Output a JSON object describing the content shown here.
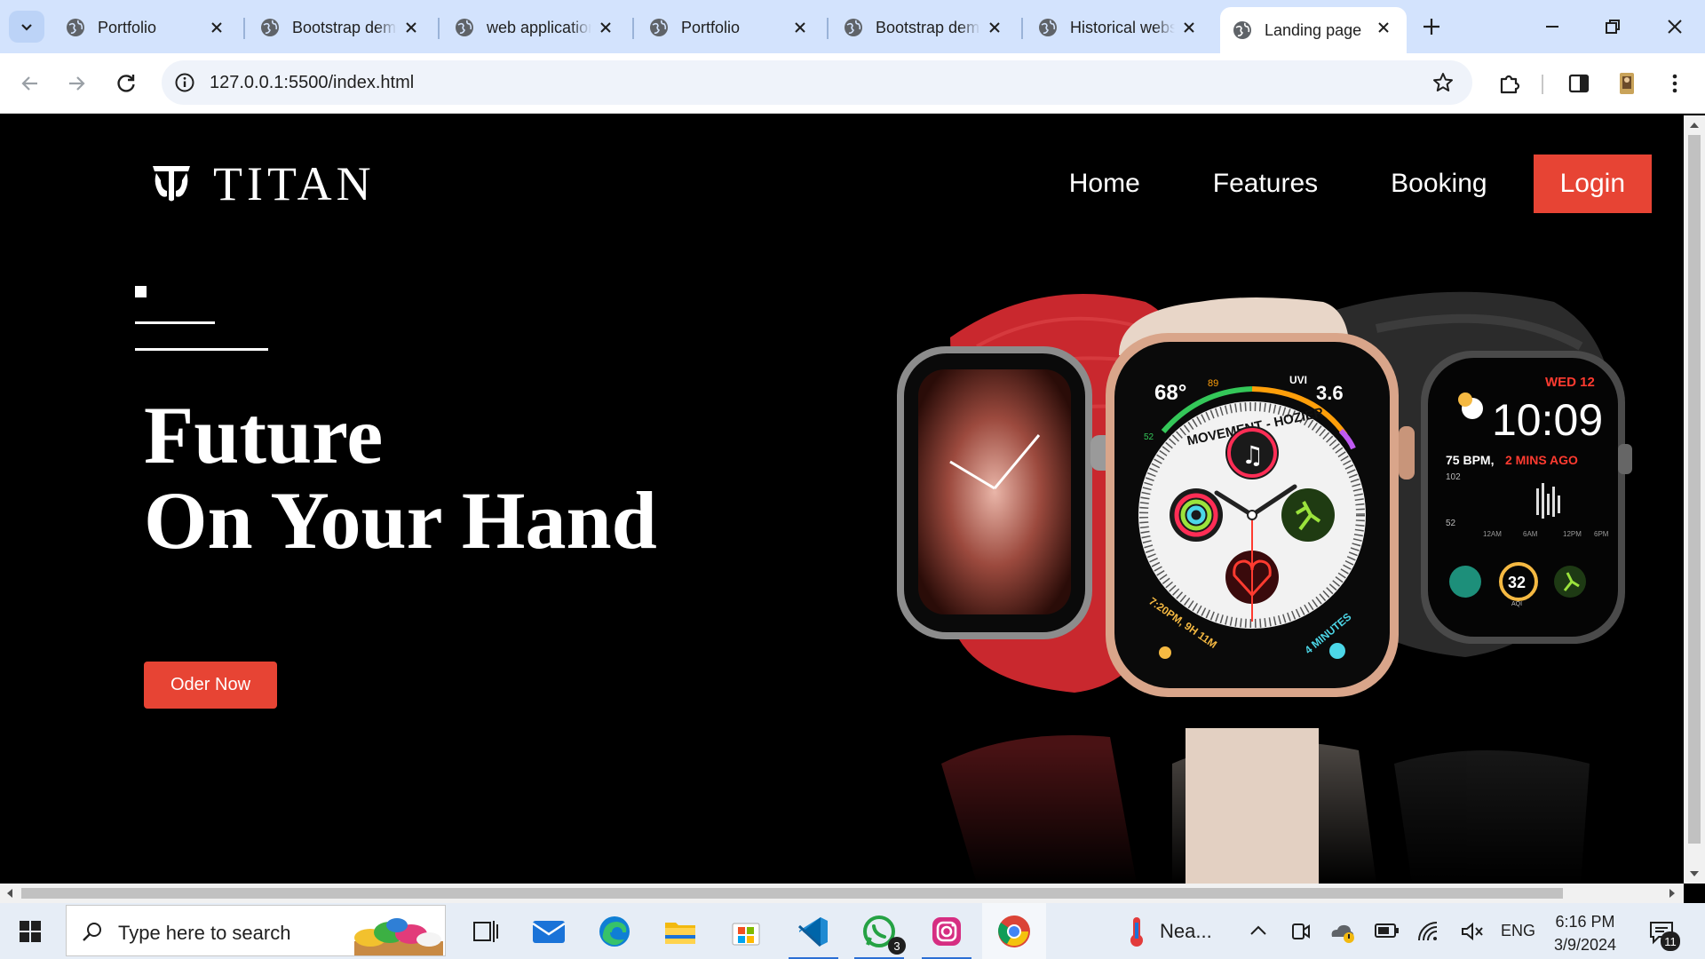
{
  "browser": {
    "tabs": [
      {
        "title": "Portfolio",
        "active": false
      },
      {
        "title": "Bootstrap demo",
        "active": false
      },
      {
        "title": "web application",
        "active": false
      },
      {
        "title": "Portfolio",
        "active": false
      },
      {
        "title": "Bootstrap demo",
        "active": false
      },
      {
        "title": "Historical website",
        "active": false
      },
      {
        "title": "Landing page",
        "active": true
      }
    ],
    "url": "127.0.0.1:5500/index.html"
  },
  "site": {
    "brand": "TITAN",
    "nav": {
      "home": "Home",
      "features": "Features",
      "booking": "Booking",
      "login": "Login"
    },
    "hero": {
      "line1": "Future",
      "line2": "On Your Hand",
      "cta": "Oder Now"
    },
    "watch_faces": {
      "center": {
        "temp": "68°",
        "hi": "89",
        "lo": "52",
        "uvi": "UVI",
        "uv_value": "3.6",
        "ring_text": "MOVEMENT - HOZIER",
        "time_text": "7:20PM, 9H 11M",
        "minutes": "4 MINUTES"
      },
      "right": {
        "date": "WED 12",
        "time": "10:09",
        "bpm": "75 BPM,",
        "ago": "2 MINS AGO",
        "hr_hi": "102",
        "hr_lo": "52",
        "aqi": "32",
        "aqi_label": "AQI",
        "t1": "12AM",
        "t2": "6AM",
        "t3": "12PM",
        "t4": "6PM"
      }
    }
  },
  "taskbar": {
    "search_placeholder": "Type here to search",
    "whatsapp_badge": "3",
    "weather": "Nea...",
    "language": "ENG",
    "time": "6:16 PM",
    "date": "3/9/2024",
    "notifications": "11"
  },
  "colors": {
    "accent": "#e74434",
    "chrome_tabstrip": "#d3e3fd",
    "page_bg": "#000000"
  }
}
